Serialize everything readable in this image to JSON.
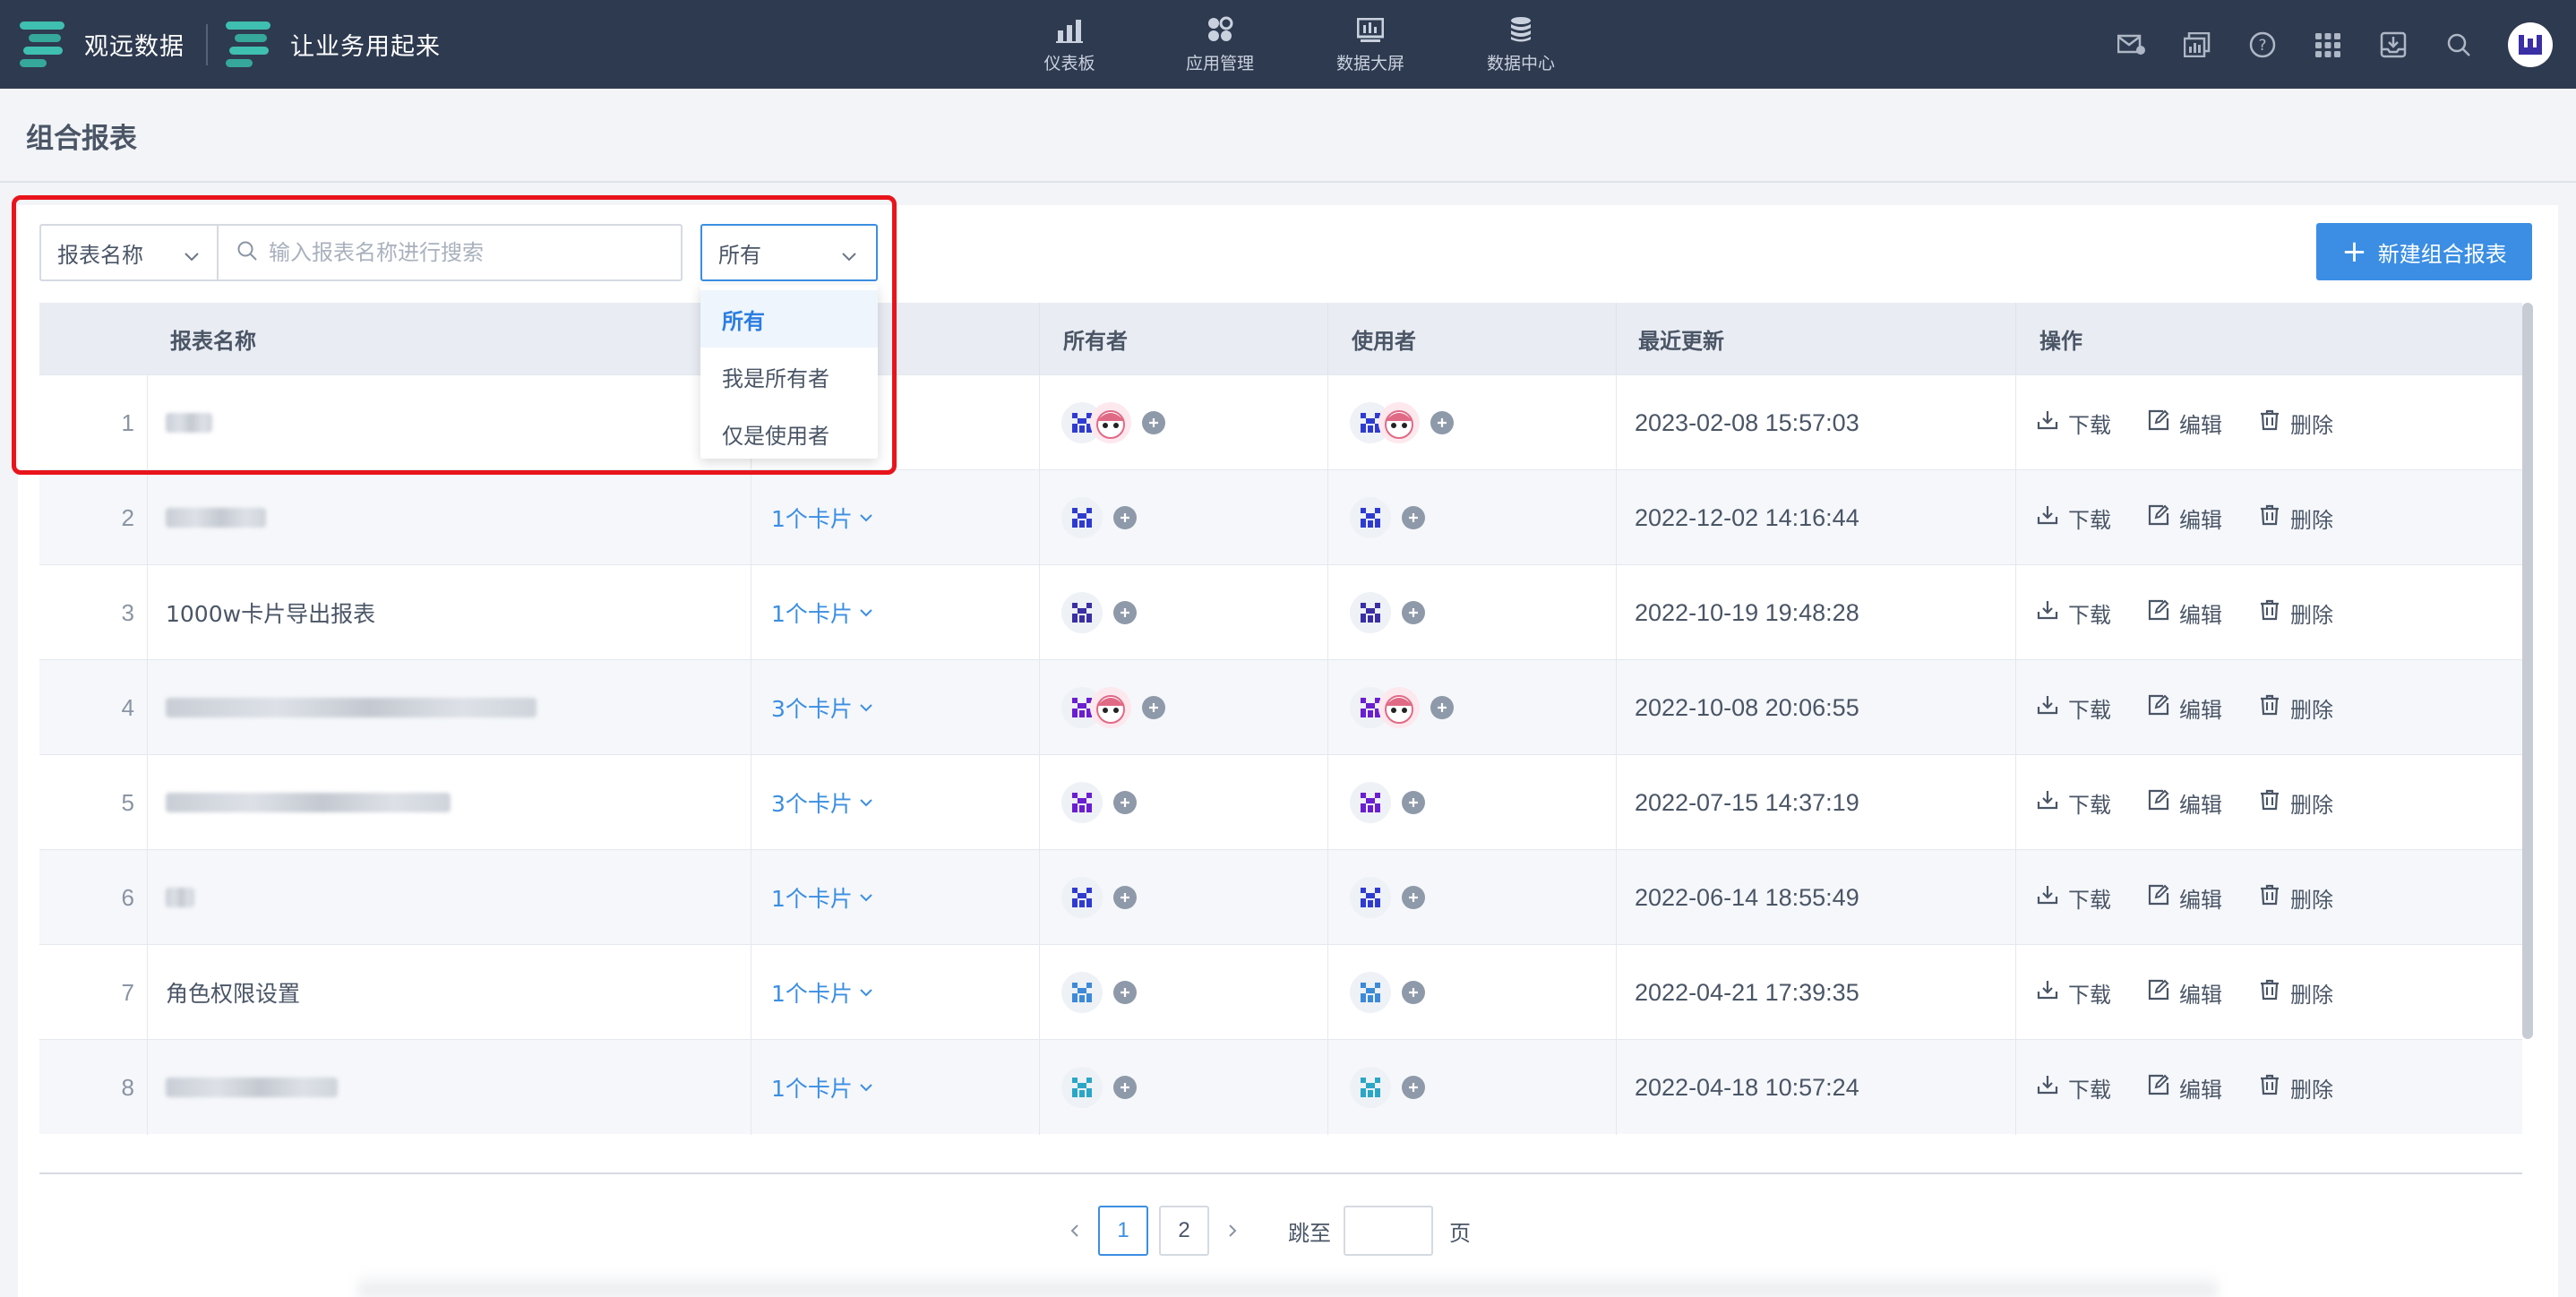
{
  "brand": {
    "name": "观远数据",
    "slogan": "让业务用起来"
  },
  "topnav": [
    {
      "label": "仪表板",
      "icon": "bar-chart-icon"
    },
    {
      "label": "应用管理",
      "icon": "apps-icon"
    },
    {
      "label": "数据大屏",
      "icon": "screen-icon"
    },
    {
      "label": "数据中心",
      "icon": "database-icon"
    }
  ],
  "topright_icons": [
    "mail-icon",
    "report-icon",
    "help-icon",
    "grid-icon",
    "download-box-icon",
    "search-icon",
    "user-avatar"
  ],
  "page": {
    "title": "组合报表"
  },
  "filter": {
    "field_select": "报表名称",
    "search_placeholder": "输入报表名称进行搜索",
    "scope_select": "所有",
    "scope_options": [
      "所有",
      "我是所有者",
      "仅是使用者"
    ]
  },
  "new_button": "新建组合报表",
  "table": {
    "headers": {
      "name": "报表名称",
      "owner": "所有者",
      "user": "使用者",
      "updated": "最近更新",
      "ops": "操作"
    },
    "ops_labels": {
      "download": "下载",
      "edit": "编辑",
      "delete": "删除"
    },
    "rows": [
      {
        "idx": "1",
        "name": "",
        "cards": "",
        "updated": "2023-02-08 15:57:03"
      },
      {
        "idx": "2",
        "name": "",
        "cards": "1个卡片",
        "updated": "2022-12-02 14:16:44"
      },
      {
        "idx": "3",
        "name": "1000w卡片导出报表",
        "cards": "1个卡片",
        "updated": "2022-10-19 19:48:28"
      },
      {
        "idx": "4",
        "name": "",
        "cards": "3个卡片",
        "updated": "2022-10-08 20:06:55"
      },
      {
        "idx": "5",
        "name": "",
        "cards": "3个卡片",
        "updated": "2022-07-15 14:37:19"
      },
      {
        "idx": "6",
        "name": "",
        "cards": "1个卡片",
        "updated": "2022-06-14 18:55:49"
      },
      {
        "idx": "7",
        "name": "角色权限设置",
        "cards": "1个卡片",
        "updated": "2022-04-21 17:39:35"
      },
      {
        "idx": "8",
        "name": "",
        "cards": "1个卡片",
        "updated": "2022-04-18 10:57:24"
      }
    ]
  },
  "pagination": {
    "pages": [
      "1",
      "2"
    ],
    "current": "1",
    "jump_label": "跳至",
    "page_label": "页"
  },
  "colors": {
    "navbar": "#2e3a4f",
    "accent": "#3b8ee3",
    "highlight": "#e8141c",
    "brand_teal": "#3fbfb0"
  }
}
